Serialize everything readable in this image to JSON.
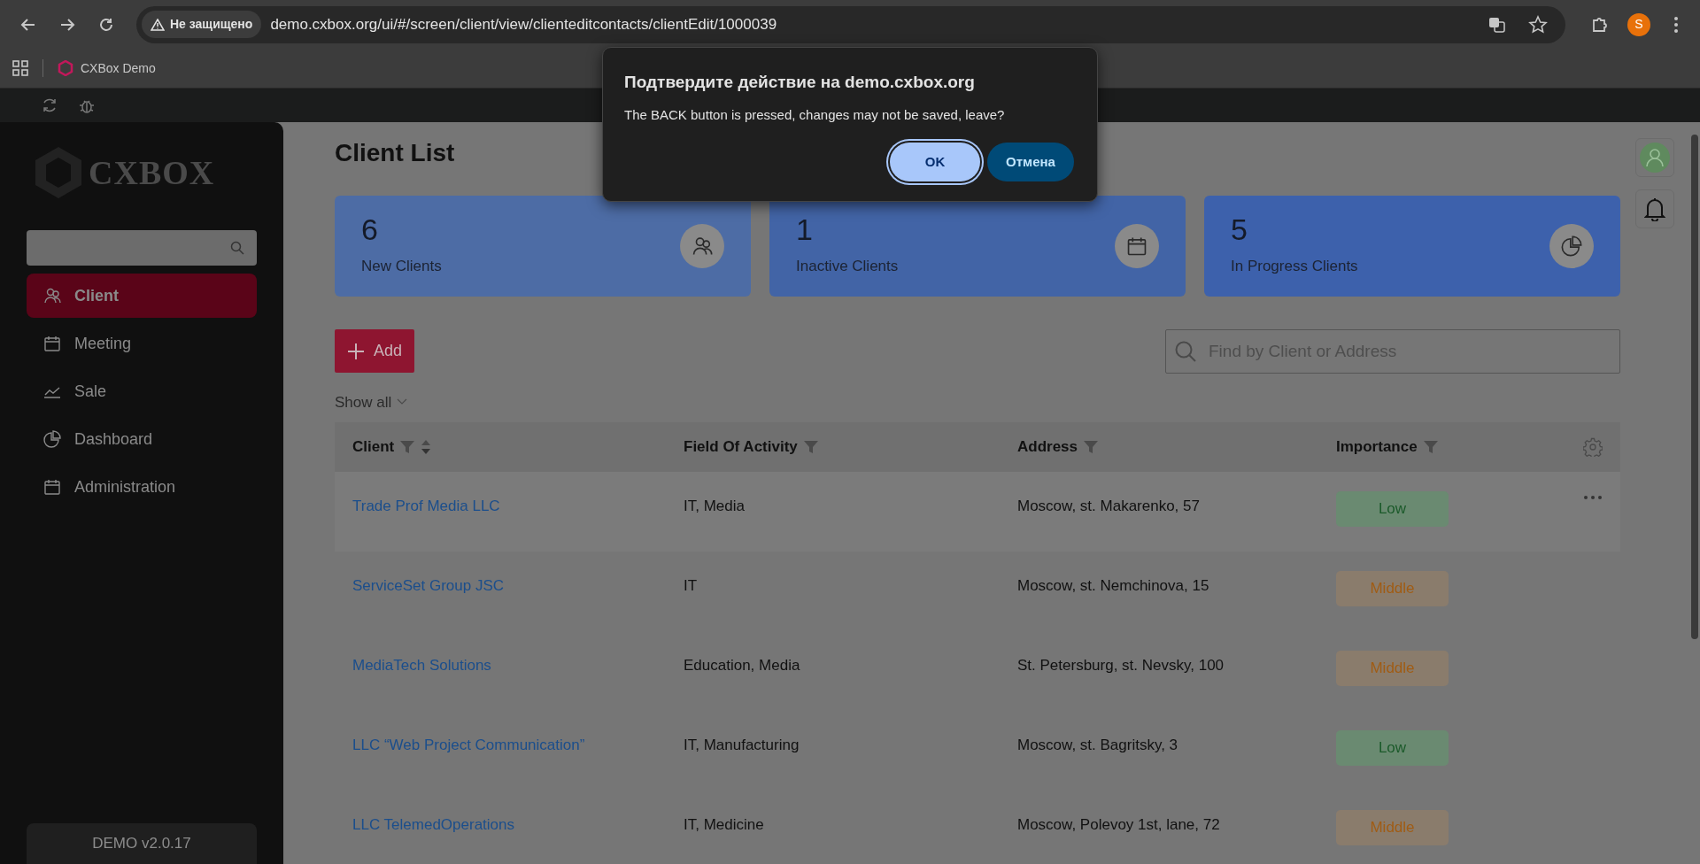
{
  "browser": {
    "security_label": "Не защищено",
    "url": "demo.cxbox.org/ui/#/screen/client/view/clienteditcontacts/clientEdit/1000039",
    "profile_initial": "S",
    "bookmarks": [
      {
        "label": "CXBox Demo"
      }
    ]
  },
  "dialog": {
    "title": "Подтвердите действие на demo.cxbox.org",
    "message": "The BACK button is pressed, changes may not be saved, leave?",
    "buttons": [
      {
        "label": "OK",
        "kind": "primary"
      },
      {
        "label": "Отмена",
        "kind": "secondary"
      }
    ]
  },
  "sidebar": {
    "logo_text": "CXBOX",
    "items": [
      {
        "label": "Client",
        "selected": true
      },
      {
        "label": "Meeting",
        "selected": false
      },
      {
        "label": "Sale",
        "selected": false
      },
      {
        "label": "Dashboard",
        "selected": false
      },
      {
        "label": "Administration",
        "selected": false
      }
    ],
    "version": "DEMO v2.0.17"
  },
  "page_title": "Client List",
  "stats": [
    {
      "value": "6",
      "label": "New Clients",
      "color": "#4d6ca5"
    },
    {
      "value": "1",
      "label": "Inactive Clients",
      "color": "#4264a6"
    },
    {
      "value": "5",
      "label": "In Progress Clients",
      "color": "#3d61ac"
    }
  ],
  "add_button": "Add",
  "search": {
    "placeholder": "Find by Client or Address"
  },
  "filter": "Show all",
  "table": {
    "columns": [
      {
        "label": "Client",
        "sortable": true
      },
      {
        "label": "Field Of Activity",
        "sortable": false
      },
      {
        "label": "Address",
        "sortable": false
      },
      {
        "label": "Importance",
        "sortable": false
      }
    ],
    "rows": [
      {
        "client": "Trade Prof Media LLC",
        "field": "IT, Media",
        "address": "Moscow, st. Makarenko, 57",
        "importance": "Low",
        "kind": "low",
        "hovered": true
      },
      {
        "client": "ServiceSet Group JSC",
        "field": "IT",
        "address": "Moscow, st. Nemchinova, 15",
        "importance": "Middle",
        "kind": "middle",
        "hovered": false
      },
      {
        "client": "MediaTech Solutions",
        "field": "Education, Media",
        "address": "St. Petersburg, st. Nevsky, 100",
        "importance": "Middle",
        "kind": "middle",
        "hovered": false
      },
      {
        "client": "LLC “Web Project Communication”",
        "field": "IT, Manufacturing",
        "address": "Moscow, st. Bagritsky, 3",
        "importance": "Low",
        "kind": "low",
        "hovered": false
      },
      {
        "client": "LLC TelemedOperations",
        "field": "IT, Medicine",
        "address": "Moscow, Polevoy 1st, lane, 72",
        "importance": "Middle",
        "kind": "middle",
        "hovered": false
      }
    ]
  }
}
